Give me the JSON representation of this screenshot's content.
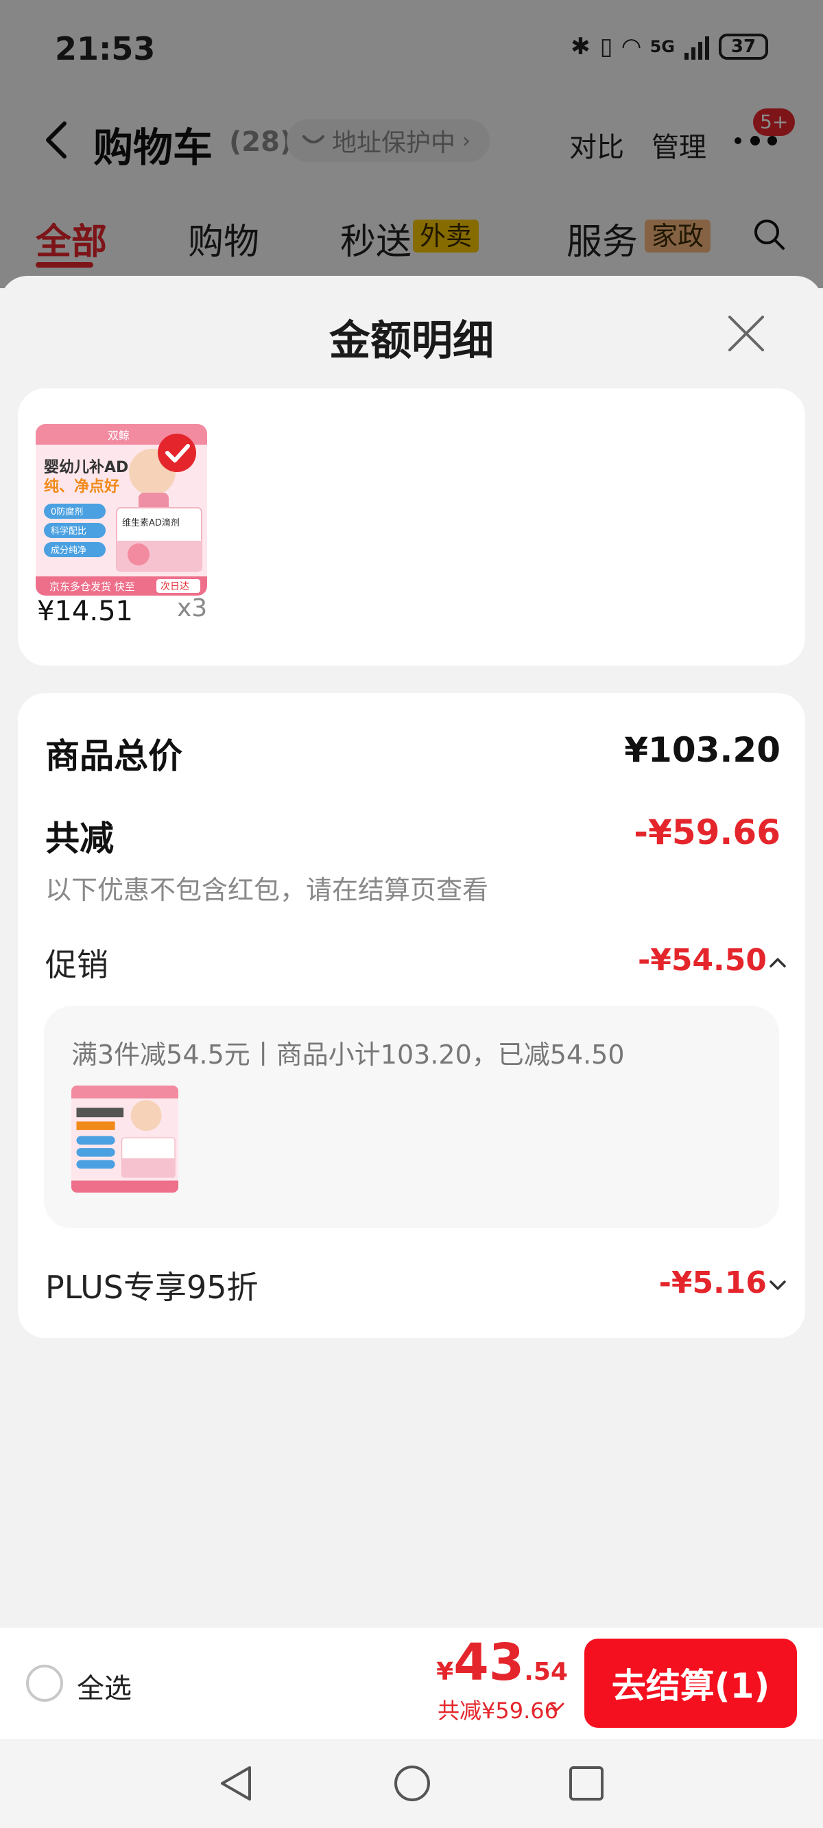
{
  "status": {
    "time": "21:53",
    "network": "5G",
    "battery": "37"
  },
  "header": {
    "title": "购物车",
    "count": "(28)",
    "address_protect": "地址保护中",
    "compare": "对比",
    "manage": "管理",
    "badge": "5+"
  },
  "tabs": [
    {
      "label": "全部",
      "active": true
    },
    {
      "label": "购物"
    },
    {
      "label": "秒送",
      "tag": "外卖",
      "tag_color": "#f5c400"
    },
    {
      "label": "服务",
      "tag": "家政",
      "tag_color": "#f0b27a"
    }
  ],
  "sheet": {
    "title": "金额明细",
    "product": {
      "image_brand": "双鲸",
      "image_headline": "婴幼儿补AD",
      "image_slogan": "纯、净点好",
      "image_bullets": [
        "0防腐剂",
        "科学配比",
        "成分纯净"
      ],
      "image_pack": "维生素AD滴剂",
      "image_footer": "京东多仓发货 快至",
      "image_footer_tag": "次日达",
      "price": "¥14.51",
      "qty": "x3"
    },
    "total_label": "商品总价",
    "total_value": "¥103.20",
    "reduce_label": "共减",
    "reduce_value": "-¥59.66",
    "note": "以下优惠不包含红包，请在结算页查看",
    "promo_label": "促销",
    "promo_value": "-¥54.50",
    "promo_desc": "满3件减54.5元丨商品小计103.20，已减54.50",
    "plus_label": "PLUS专享95折",
    "plus_value": "-¥5.16"
  },
  "bottom": {
    "select_all": "全选",
    "currency": "¥",
    "total_int": "43",
    "total_dec": ".54",
    "saved": "共减¥59.66",
    "checkout": "去结算(1)"
  },
  "colors": {
    "accent": "#e4262c",
    "checkout": "#f5101f"
  }
}
